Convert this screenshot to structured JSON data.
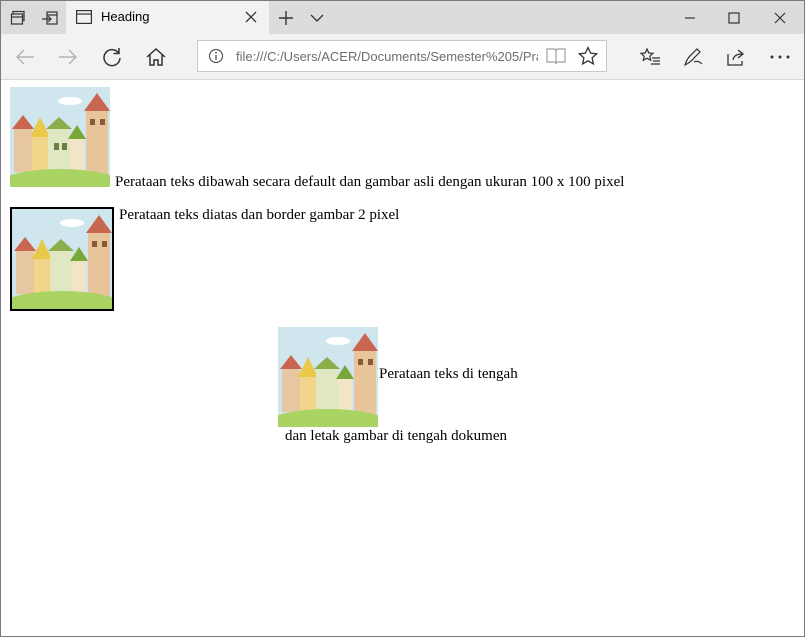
{
  "browser": {
    "tab_title": "Heading",
    "address_url": "file:///C:/Users/ACER/Documents/Semester%205/Pra",
    "icons": {
      "tab_actions": "tab-actions-icon",
      "set_aside": "set-aside-tabs-icon",
      "page": "page-icon",
      "close_tab": "close-icon",
      "new_tab": "plus-icon",
      "tab_menu": "chevron-down-icon",
      "minimize": "minimize-icon",
      "maximize": "maximize-icon",
      "close_window": "close-icon",
      "back": "back-arrow-icon",
      "forward": "forward-arrow-icon",
      "refresh": "refresh-icon",
      "home": "home-icon",
      "info": "info-icon",
      "reading_view": "book-icon",
      "favorite": "star-icon",
      "favorites_hub": "favorites-list-icon",
      "notes": "pen-icon",
      "share": "share-icon",
      "more": "more-icon"
    }
  },
  "page": {
    "line1": "Perataan teks dibawah secara default dan gambar asli dengan ukuran 100 x 100 pixel",
    "line2": "Perataan teks diatas dan border gambar 2 pixel",
    "line3": "Perataan teks di tengah",
    "line4": "dan letak gambar di tengah dokumen"
  },
  "colors": {
    "titlebar": "#dcdcdc",
    "active_tab": "#f2f2f2",
    "toolbar": "#f2f2f2"
  }
}
